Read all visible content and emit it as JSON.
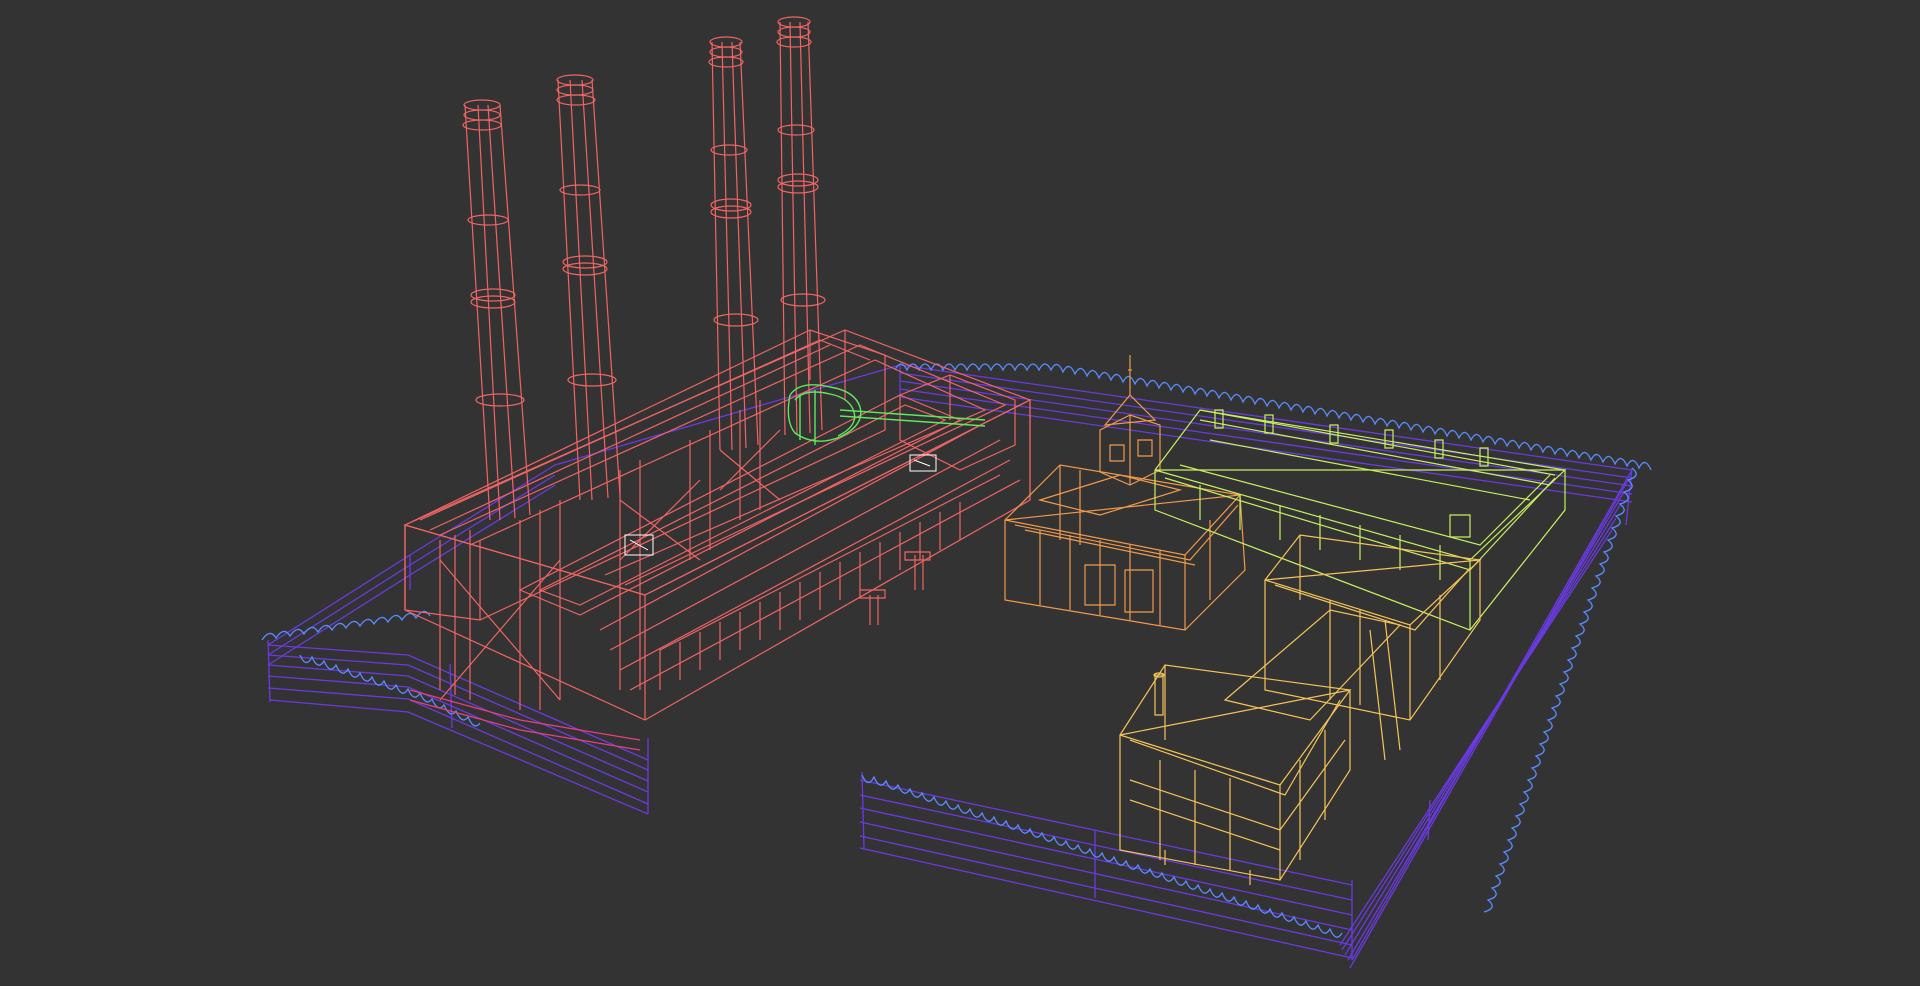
{
  "viewport": {
    "background": "#333333",
    "render_mode": "wireframe"
  },
  "scene": {
    "objects": [
      {
        "name": "power-station-building",
        "color": "#f06464"
      },
      {
        "name": "smokestacks",
        "color": "#f06464",
        "count": 4
      },
      {
        "name": "pipe-bridge",
        "color": "#5fe85f"
      },
      {
        "name": "clock-tower-building",
        "color": "#f09a4c"
      },
      {
        "name": "long-hall-building",
        "color": "#c8f060"
      },
      {
        "name": "workshop-building",
        "color": "#f5c458"
      },
      {
        "name": "perimeter-fence",
        "color": "#6a3ae0"
      },
      {
        "name": "barbed-wire",
        "color": "#5a8cff"
      }
    ]
  }
}
